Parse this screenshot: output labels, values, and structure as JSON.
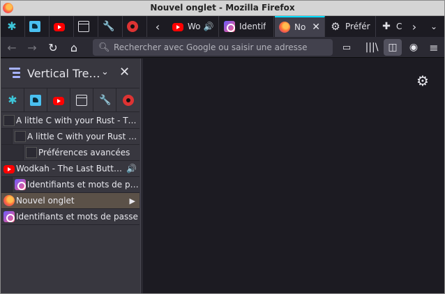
{
  "window": {
    "title": "Nouvel onglet - Mozilla Firefox"
  },
  "tabs": [
    {
      "icon": "puzzle-icon",
      "label": ""
    },
    {
      "icon": "bird-icon",
      "label": ""
    },
    {
      "icon": "youtube-icon",
      "label": ""
    },
    {
      "icon": "window-icon",
      "label": ""
    },
    {
      "icon": "wrench-icon",
      "label": ""
    },
    {
      "icon": "red-record-icon",
      "label": ""
    },
    {
      "icon": "youtube-icon",
      "label": "Wo"
    },
    {
      "icon": "lock-icon",
      "label": "Identif"
    },
    {
      "icon": "firefox-icon",
      "label": "No"
    },
    {
      "icon": "gear-icon",
      "label": "Préfér"
    },
    {
      "icon": "extension-icon",
      "label": "C"
    }
  ],
  "navbar": {
    "url_placeholder": "Rechercher avec Google ou saisir une adresse"
  },
  "sidebar": {
    "title": "Vertical Tre…",
    "tree": [
      {
        "label": "A little C with your Rust - The …",
        "level": 0
      },
      {
        "label": "A little C with your Rust - T…",
        "level": 1
      },
      {
        "label": "Préférences avancées",
        "level": 2
      },
      {
        "label": "Wodkah - The Last Butterf…",
        "level": 0
      },
      {
        "label": "Identifiants et mots de pa…",
        "level": 1
      },
      {
        "label": "Nouvel onglet",
        "level": 0
      },
      {
        "label": "Identifiants et mots de passe",
        "level": 0
      }
    ]
  },
  "colors": {
    "accent": "#00ddff",
    "active_row": "#5b5148",
    "toolbar": "#2b2a33",
    "background": "#1c1b22"
  }
}
